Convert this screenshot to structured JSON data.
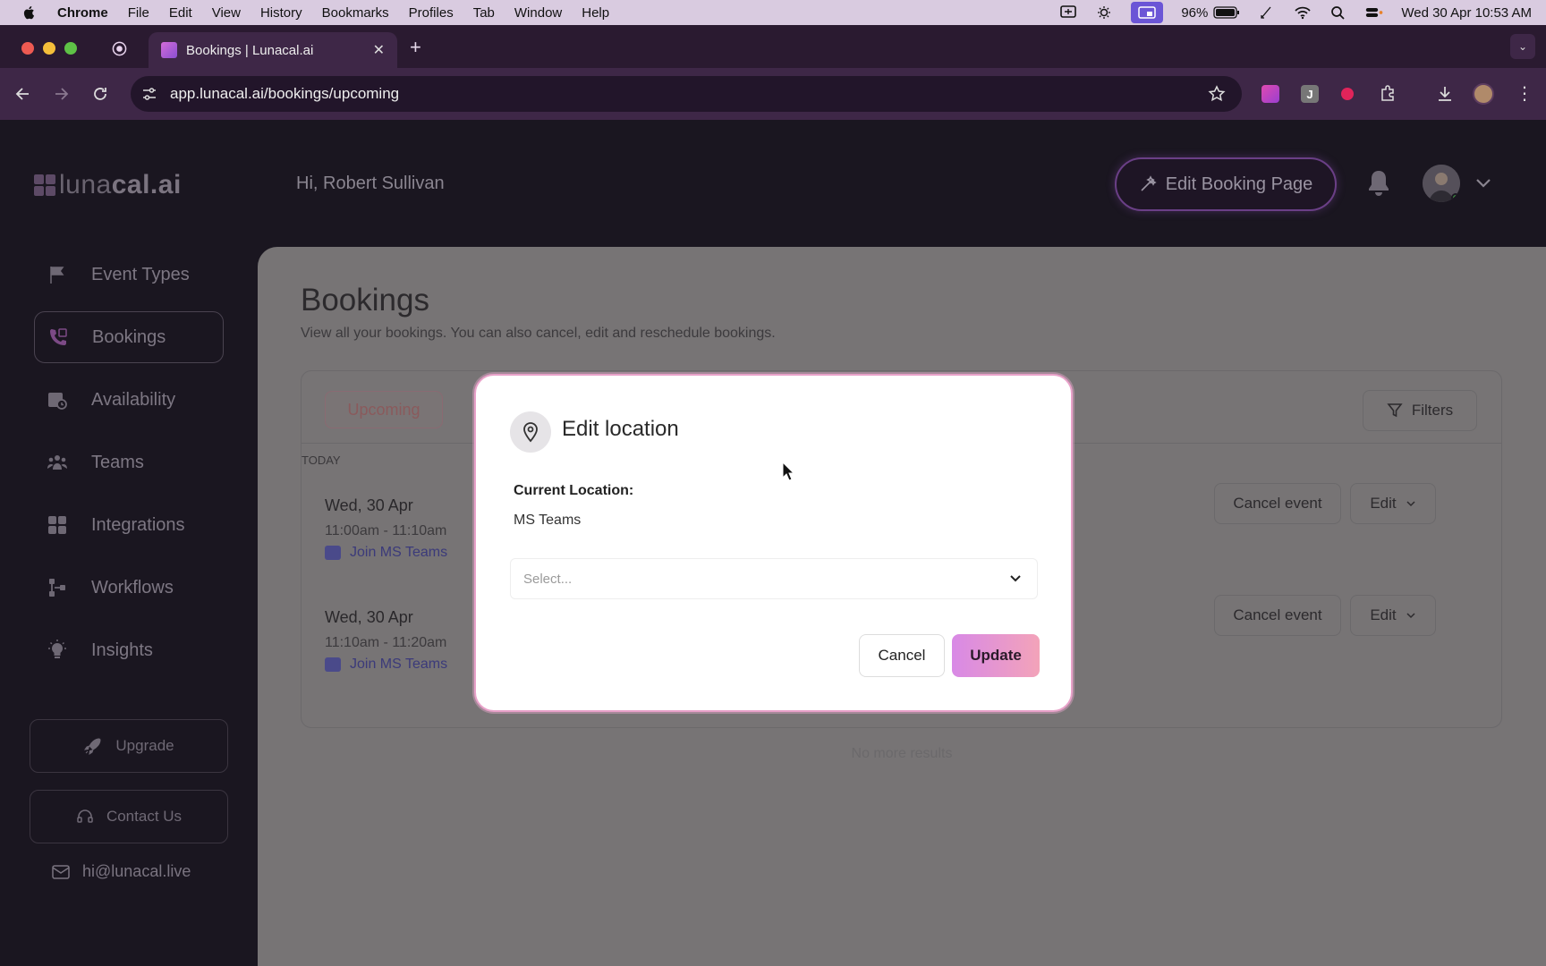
{
  "menubar": {
    "app": "Chrome",
    "items": [
      "File",
      "Edit",
      "View",
      "History",
      "Bookmarks",
      "Profiles",
      "Tab",
      "Window",
      "Help"
    ],
    "battery": "96%",
    "datetime": "Wed 30 Apr  10:53 AM"
  },
  "browser": {
    "tab_title": "Bookings | Lunacal.ai",
    "url": "app.lunacal.ai/bookings/upcoming"
  },
  "header": {
    "logo_light": "luna",
    "logo_bold": "cal.ai",
    "greeting": "Hi, Robert Sullivan",
    "edit_booking_page": "Edit Booking Page"
  },
  "sidebar": {
    "items": [
      {
        "label": "Event Types",
        "icon": "flag-icon"
      },
      {
        "label": "Bookings",
        "icon": "phone-calendar-icon",
        "active": true
      },
      {
        "label": "Availability",
        "icon": "calendar-clock-icon"
      },
      {
        "label": "Teams",
        "icon": "users-icon"
      },
      {
        "label": "Integrations",
        "icon": "grid-icon"
      },
      {
        "label": "Workflows",
        "icon": "workflow-icon"
      },
      {
        "label": "Insights",
        "icon": "lightbulb-icon"
      }
    ],
    "upgrade": "Upgrade",
    "contact": "Contact Us",
    "email": "hi@lunacal.live"
  },
  "main": {
    "title": "Bookings",
    "subtitle": "View all your bookings. You can also cancel, edit and reschedule bookings.",
    "tab_upcoming": "Upcoming",
    "filters": "Filters",
    "section_label": "TODAY",
    "bookings": [
      {
        "date": "Wed, 30 Apr",
        "time": "11:00am - 11:10am",
        "join": "Join MS Teams",
        "cancel": "Cancel event",
        "edit": "Edit"
      },
      {
        "date": "Wed, 30 Apr",
        "time": "11:10am - 11:20am",
        "join": "Join MS Teams",
        "cancel": "Cancel event",
        "edit": "Edit"
      }
    ],
    "no_more": "No more results"
  },
  "modal": {
    "title": "Edit location",
    "current_label": "Current Location:",
    "current_value": "MS Teams",
    "select_placeholder": "Select...",
    "cancel": "Cancel",
    "update": "Update"
  },
  "colors": {
    "accent_gradient_start": "#d889e6",
    "accent_gradient_end": "#f3a3b9",
    "modal_border": "#e8a1c9"
  }
}
